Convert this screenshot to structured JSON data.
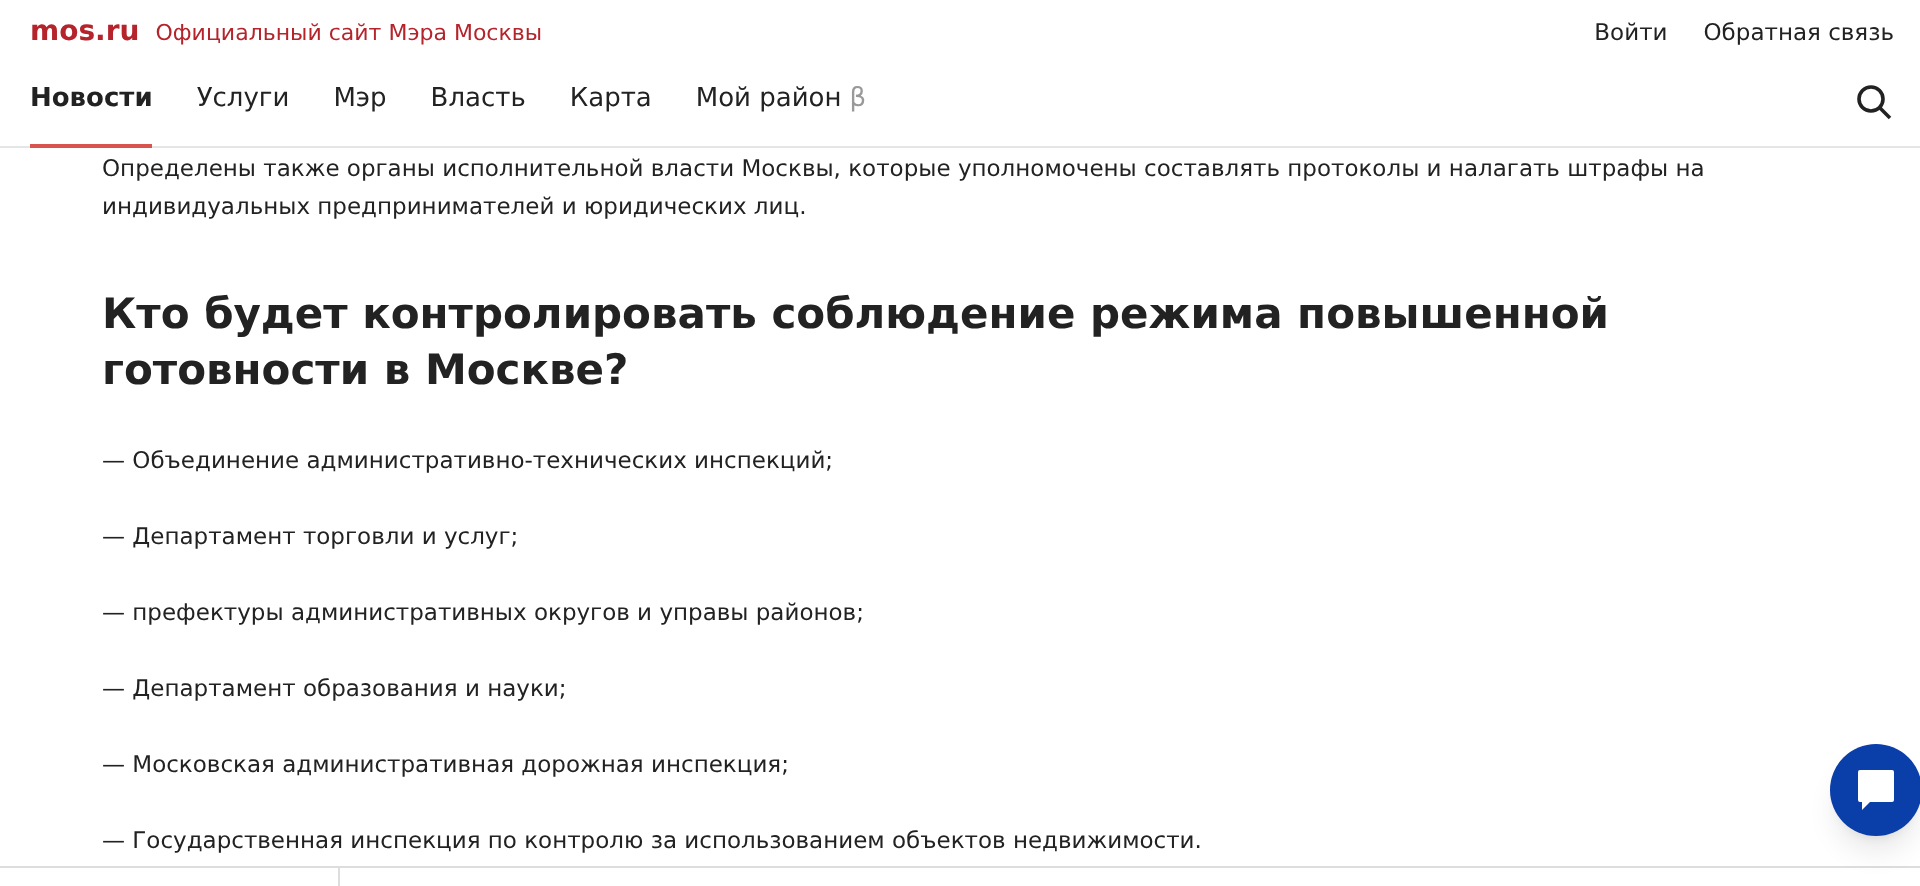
{
  "header": {
    "logo": "mos.ru",
    "site_title": "Официальный сайт Мэра Москвы",
    "links": [
      "Войти",
      "Обратная связь"
    ]
  },
  "nav": {
    "items": [
      {
        "label": "Новости",
        "selected": true
      },
      {
        "label": "Услуги",
        "selected": false
      },
      {
        "label": "Мэр",
        "selected": false
      },
      {
        "label": "Власть",
        "selected": false
      },
      {
        "label": "Карта",
        "selected": false
      },
      {
        "label": "Мой район",
        "badge": "β",
        "selected": false
      }
    ]
  },
  "article": {
    "intro": "Определены также органы исполнительной власти Москвы, которые уполномочены составлять протоколы и налагать штрафы на индивидуальных предпринимателей и юридических лиц.",
    "heading": "Кто будет контролировать соблюдение режима повышенной готовности в Москве?",
    "list": [
      "— Объединение административно-технических инспекций;",
      "— Департамент торговли и услуг;",
      "— префектуры административных округов и управы районов;",
      "— Департамент образования и науки;",
      "— Московская административная дорожная инспекция;",
      "— Государственная инспекция по контролю за использованием объектов недвижимости."
    ]
  }
}
